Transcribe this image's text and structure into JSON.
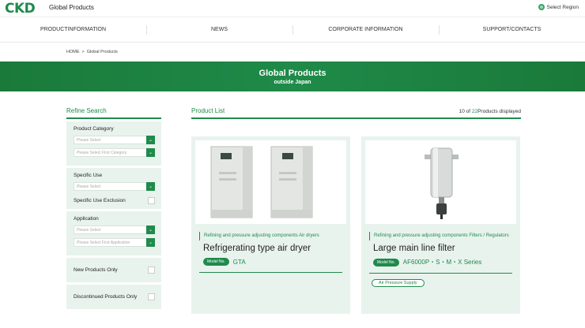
{
  "header": {
    "logo": "CKD",
    "site_title": "Global Products",
    "region_label": "Select Region"
  },
  "nav": [
    {
      "label": "PRODUCTINFORMATION"
    },
    {
      "label": "NEWS"
    },
    {
      "label": "CORPORATE INFORMATION"
    },
    {
      "label": "SUPPORT/CONTACTS"
    }
  ],
  "breadcrumb": {
    "home": "HOME",
    "separator": ">",
    "current": "Global Products"
  },
  "hero": {
    "title": "Global Products",
    "subtitle": "outside Japan"
  },
  "refine": {
    "title": "Refine Search",
    "product_category": {
      "label": "Product Category",
      "select1": "Please Select",
      "select2": "Please Select First Category"
    },
    "specific_use": {
      "label": "Specific Use",
      "select1": "Please Select",
      "exclusion": "Specific Use Exclusion"
    },
    "application": {
      "label": "Application",
      "select1": "Please Select",
      "select2": "Please Select First Application"
    },
    "new_only": "New Products Only",
    "discontinued_only": "Discontinued Products Only"
  },
  "product_list": {
    "title": "Product List",
    "count_prefix": "10 of ",
    "count_total": "22",
    "count_suffix": "Products displayed"
  },
  "products": [
    {
      "category": "Refining and pressure adjusting components Air dryers",
      "name": "Refrigerating type air dryer",
      "model_badge": "Model No.",
      "model": "GTA"
    },
    {
      "category": "Refining and pressure adjusting components Filters / Regulators",
      "name": "Large main line filter",
      "model_badge": "Model No.",
      "model": "AF6000P・S・M・X Series",
      "tag": "Air Pressure Supply"
    }
  ],
  "colors": {
    "accent": "#1f8a4c",
    "panel": "#e9f3ee"
  }
}
